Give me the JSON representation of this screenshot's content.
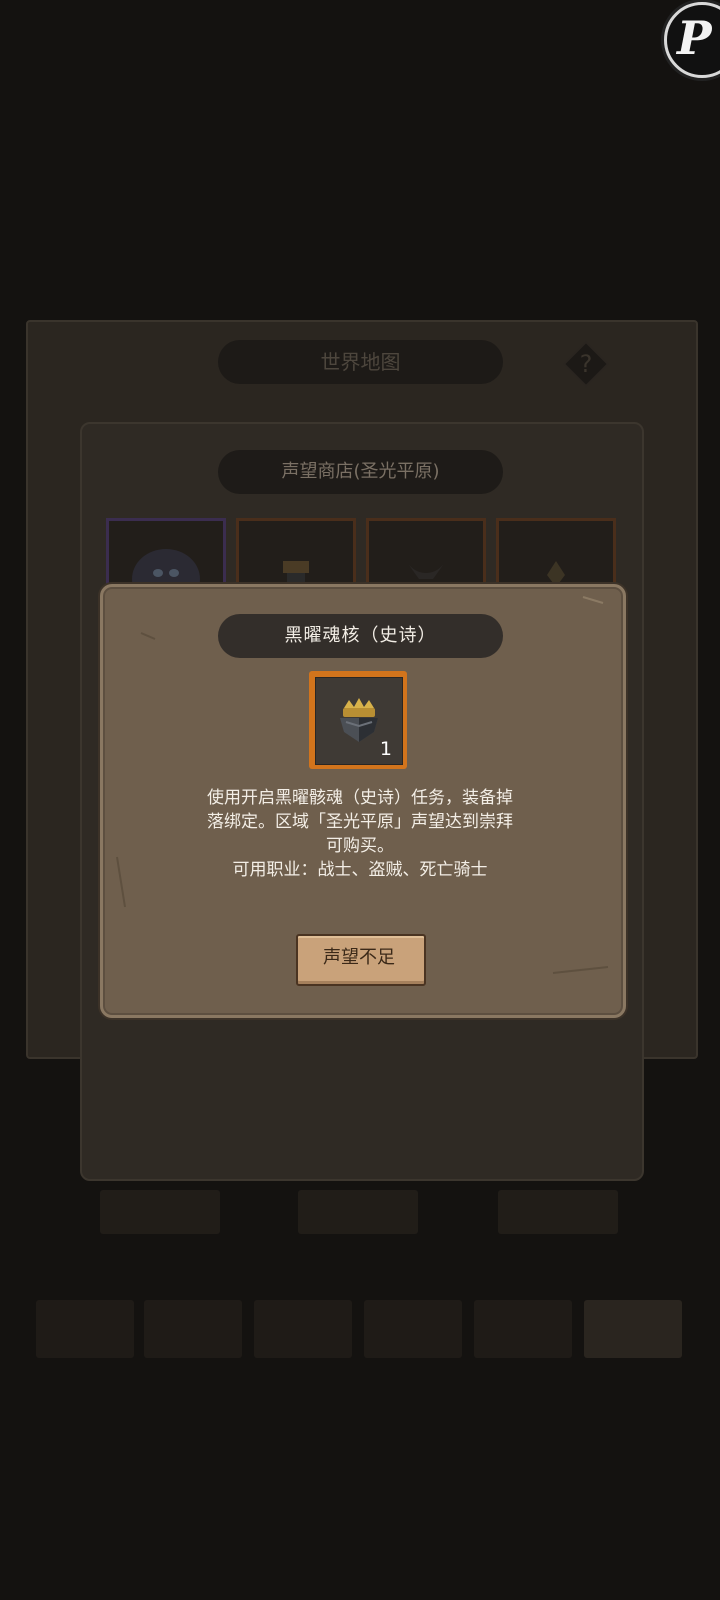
{
  "world_map": {
    "title": "世界地图",
    "help_symbol": "?",
    "bottom_buttons": [
      "",
      "",
      ""
    ],
    "tabs": [
      "",
      "",
      "",
      "",
      "",
      "",
      ""
    ]
  },
  "shop": {
    "title": "声望商店(圣光平原)"
  },
  "dialog": {
    "title": "黑曜魂核（史诗）",
    "item_count": "1",
    "description_lines": [
      "使用开启黑曜骸魂（史诗）任务，装备掉",
      "落绑定。区域「圣光平原」声望达到崇拜",
      "可购买。",
      "可用职业：战士、盗贼、死亡骑士"
    ],
    "button_label": "声望不足",
    "item_icon": "obsidian-soul-core-icon"
  },
  "corner_badge": {
    "letter": "P"
  },
  "colors": {
    "dialog_bg": "#6f5f4d",
    "item_frame": "#d2741c",
    "button_wood": "#c9a27a"
  }
}
